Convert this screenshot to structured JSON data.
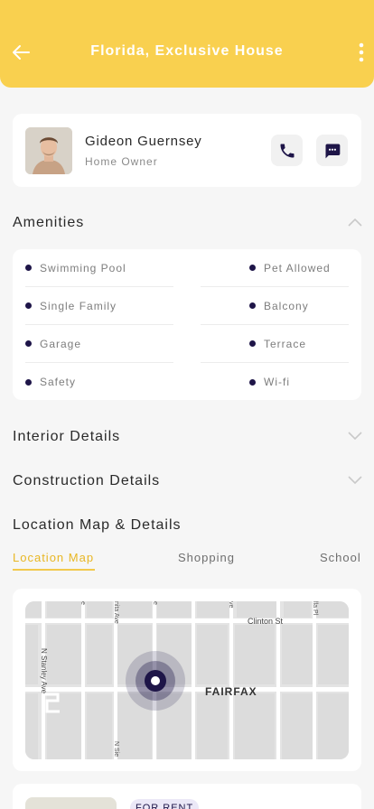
{
  "header": {
    "title": "Florida, Exclusive House",
    "back_icon": "arrow-left-icon",
    "menu_icon": "more-vertical-icon"
  },
  "owner": {
    "name": "Gideon Guernsey",
    "role": "Home Owner",
    "call_icon": "phone-icon",
    "message_icon": "chat-icon"
  },
  "amenities": {
    "title": "Amenities",
    "left": [
      "Swimming Pool",
      "Single Family",
      "Garage",
      "Safety"
    ],
    "right": [
      "Pet Allowed",
      "Balcony",
      "Terrace",
      "Wi-fi"
    ]
  },
  "sections": {
    "interior": "Interior Details",
    "construction": "Construction Details",
    "location": "Location Map & Details"
  },
  "tabs": [
    "Location Map",
    "Shopping",
    "School"
  ],
  "map": {
    "streets": [
      "Clinton St",
      "N Stanley Ave",
      "FAIRFAX"
    ]
  },
  "listing": {
    "badge": "FOR RENT"
  },
  "colors": {
    "accent": "#f9d04f",
    "tab_active": "#e8b724",
    "navy": "#1e1548"
  }
}
